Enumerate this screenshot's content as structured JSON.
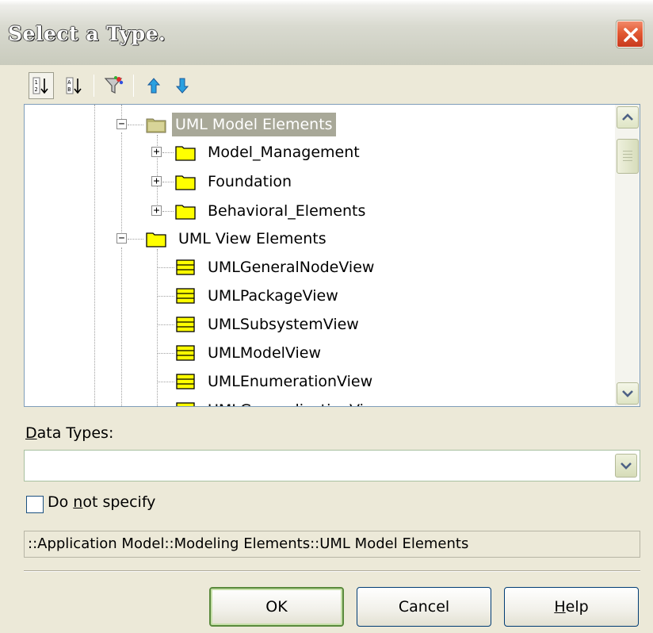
{
  "window": {
    "title": "Select a Type."
  },
  "toolbar": {
    "buttons": [
      {
        "name": "sort-by-category",
        "icon": "sort-numeric-icon",
        "active": true
      },
      {
        "name": "sort-alphabetical",
        "icon": "sort-alpha-icon",
        "active": false
      },
      {
        "name": "filter",
        "icon": "filter-icon",
        "active": false
      },
      {
        "name": "move-up",
        "icon": "arrow-up-icon",
        "active": false
      },
      {
        "name": "move-down",
        "icon": "arrow-down-icon",
        "active": false
      }
    ]
  },
  "tree": {
    "nodes": [
      {
        "label": "UML Model Elements",
        "type": "folder-open",
        "expanded": true,
        "selected": true
      },
      {
        "label": "Model_Management",
        "type": "folder",
        "expanded": false
      },
      {
        "label": "Foundation",
        "type": "folder",
        "expanded": false
      },
      {
        "label": "Behavioral_Elements",
        "type": "folder",
        "expanded": false
      },
      {
        "label": "UML View Elements",
        "type": "folder",
        "expanded": true
      },
      {
        "label": "UMLGeneralNodeView",
        "type": "class"
      },
      {
        "label": "UMLPackageView",
        "type": "class"
      },
      {
        "label": "UMLSubsystemView",
        "type": "class"
      },
      {
        "label": "UMLModelView",
        "type": "class"
      },
      {
        "label": "UMLEnumerationView",
        "type": "class"
      },
      {
        "label": "UMLGeneralizationView",
        "type": "class"
      }
    ]
  },
  "data_types": {
    "label_prefix": "D",
    "label_rest": "ata Types:",
    "value": ""
  },
  "do_not_specify": {
    "label_before": "Do ",
    "label_accel": "n",
    "label_after": "ot specify",
    "checked": false
  },
  "path": {
    "value": "::Application Model::Modeling Elements::UML Model Elements"
  },
  "buttons": {
    "ok": "OK",
    "cancel": "Cancel",
    "help_accel": "H",
    "help_rest": "elp"
  },
  "colors": {
    "dialog_bg": "#ece9d8",
    "close_red": "#e25a34",
    "selection_bg": "#a8a898",
    "folder_yellow": "#ffff00"
  }
}
